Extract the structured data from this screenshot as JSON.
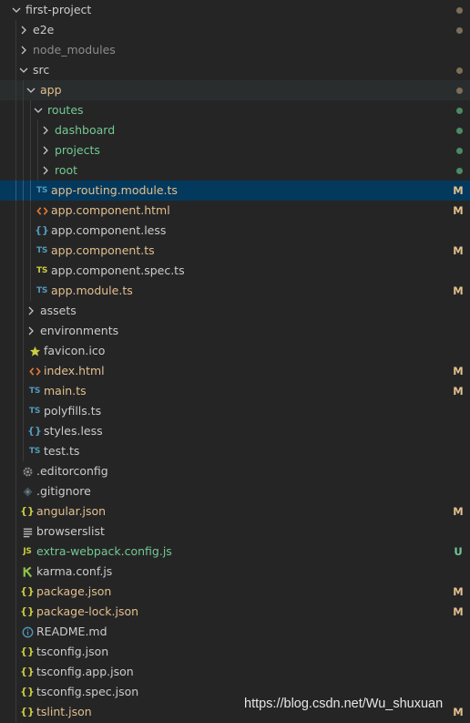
{
  "colors": {
    "modified": "#e2c08d",
    "untracked": "#73c991",
    "ignored": "#8c8c8c",
    "default": "#cccccc",
    "selection": "#04395e",
    "background": "#252526"
  },
  "tree": [
    {
      "label": "first-project",
      "type": "folder",
      "expanded": true,
      "depth": 0,
      "status": "dot-modified"
    },
    {
      "label": "e2e",
      "type": "folder",
      "expanded": false,
      "depth": 1,
      "status": "dot-modified"
    },
    {
      "label": "node_modules",
      "type": "folder",
      "expanded": false,
      "depth": 1,
      "status": "ignored"
    },
    {
      "label": "src",
      "type": "folder",
      "expanded": true,
      "depth": 1,
      "status": "dot-modified"
    },
    {
      "label": "app",
      "type": "folder",
      "expanded": true,
      "depth": 2,
      "status": "dot-modified",
      "hover": true
    },
    {
      "label": "routes",
      "type": "folder",
      "expanded": true,
      "depth": 3,
      "status": "dot-untracked"
    },
    {
      "label": "dashboard",
      "type": "folder",
      "expanded": false,
      "depth": 4,
      "status": "dot-untracked"
    },
    {
      "label": "projects",
      "type": "folder",
      "expanded": false,
      "depth": 4,
      "status": "dot-untracked"
    },
    {
      "label": "root",
      "type": "folder",
      "expanded": false,
      "depth": 4,
      "status": "dot-untracked"
    },
    {
      "label": "app-routing.module.ts",
      "type": "file",
      "icon": "typescript-icon",
      "depth": 3,
      "status": "M",
      "selected": true
    },
    {
      "label": "app.component.html",
      "type": "file",
      "icon": "html-icon",
      "depth": 3,
      "status": "M"
    },
    {
      "label": "app.component.less",
      "type": "file",
      "icon": "less-icon",
      "depth": 3,
      "status": ""
    },
    {
      "label": "app.component.ts",
      "type": "file",
      "icon": "typescript-icon",
      "depth": 3,
      "status": "M"
    },
    {
      "label": "app.component.spec.ts",
      "type": "file",
      "icon": "typescript-spec-icon",
      "depth": 3,
      "status": ""
    },
    {
      "label": "app.module.ts",
      "type": "file",
      "icon": "typescript-icon",
      "depth": 3,
      "status": "M"
    },
    {
      "label": "assets",
      "type": "folder",
      "expanded": false,
      "depth": 2,
      "status": ""
    },
    {
      "label": "environments",
      "type": "folder",
      "expanded": false,
      "depth": 2,
      "status": ""
    },
    {
      "label": "favicon.ico",
      "type": "file",
      "icon": "star-icon",
      "depth": 2,
      "status": ""
    },
    {
      "label": "index.html",
      "type": "file",
      "icon": "html-icon",
      "depth": 2,
      "status": "M"
    },
    {
      "label": "main.ts",
      "type": "file",
      "icon": "typescript-icon",
      "depth": 2,
      "status": "M"
    },
    {
      "label": "polyfills.ts",
      "type": "file",
      "icon": "typescript-icon",
      "depth": 2,
      "status": ""
    },
    {
      "label": "styles.less",
      "type": "file",
      "icon": "less-icon",
      "depth": 2,
      "status": ""
    },
    {
      "label": "test.ts",
      "type": "file",
      "icon": "typescript-icon",
      "depth": 2,
      "status": ""
    },
    {
      "label": ".editorconfig",
      "type": "file",
      "icon": "gear-icon",
      "depth": 1,
      "status": ""
    },
    {
      "label": ".gitignore",
      "type": "file",
      "icon": "git-icon",
      "depth": 1,
      "status": ""
    },
    {
      "label": "angular.json",
      "type": "file",
      "icon": "json-icon",
      "depth": 1,
      "status": "M"
    },
    {
      "label": "browserslist",
      "type": "file",
      "icon": "lines-icon",
      "depth": 1,
      "status": ""
    },
    {
      "label": "extra-webpack.config.js",
      "type": "file",
      "icon": "javascript-icon",
      "depth": 1,
      "status": "U"
    },
    {
      "label": "karma.conf.js",
      "type": "file",
      "icon": "karma-icon",
      "depth": 1,
      "status": ""
    },
    {
      "label": "package.json",
      "type": "file",
      "icon": "json-icon",
      "depth": 1,
      "status": "M"
    },
    {
      "label": "package-lock.json",
      "type": "file",
      "icon": "json-icon",
      "depth": 1,
      "status": "M"
    },
    {
      "label": "README.md",
      "type": "file",
      "icon": "info-icon",
      "depth": 1,
      "status": ""
    },
    {
      "label": "tsconfig.json",
      "type": "file",
      "icon": "json-icon",
      "depth": 1,
      "status": ""
    },
    {
      "label": "tsconfig.app.json",
      "type": "file",
      "icon": "json-icon",
      "depth": 1,
      "status": ""
    },
    {
      "label": "tsconfig.spec.json",
      "type": "file",
      "icon": "json-icon",
      "depth": 1,
      "status": ""
    },
    {
      "label": "tslint.json",
      "type": "file",
      "icon": "json-icon",
      "depth": 1,
      "status": "M"
    }
  ],
  "icon_glyphs": {
    "typescript": "TS",
    "javascript": "JS",
    "json": "{}"
  },
  "watermark": "https://blog.csdn.net/Wu_shuxuan"
}
